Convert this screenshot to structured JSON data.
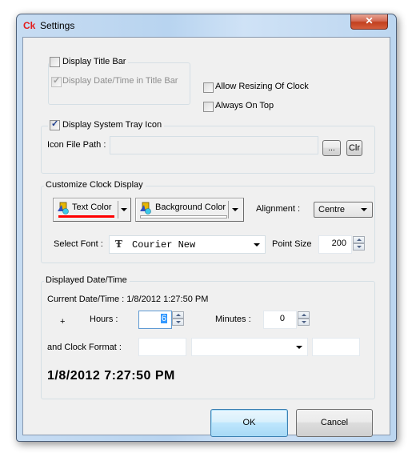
{
  "window": {
    "app_icon": "Ck",
    "title": "Settings",
    "close_label": "✕"
  },
  "title_bar_group": {
    "display_title_bar": {
      "label": "Display Title Bar",
      "checked": false
    },
    "display_datetime_in_title_bar": {
      "label": "Display Date/Time in Title Bar",
      "checked": true,
      "disabled": true
    }
  },
  "options": {
    "allow_resizing": {
      "label": "Allow Resizing Of Clock",
      "checked": false
    },
    "always_on_top": {
      "label": "Always On Top",
      "checked": false
    }
  },
  "tray_group": {
    "display_tray_icon": {
      "label": "Display System Tray Icon",
      "checked": true
    },
    "icon_path_label": "Icon File Path :",
    "icon_path_value": "",
    "browse_label": "...",
    "clear_label": "Clr"
  },
  "customize_group": {
    "legend": "Customize Clock Display",
    "text_color_label": "Text Color",
    "text_color_value": "#ff0000",
    "background_color_label": "Background Color",
    "background_color_value": "#ffffff",
    "alignment_label": "Alignment :",
    "alignment_value": "Centre",
    "font_label": "Select Font :",
    "font_value": "Courier New",
    "font_icon": "truetype-font-icon",
    "point_size_label": "Point Size",
    "point_size_value": "200"
  },
  "datetime_group": {
    "legend": "Displayed Date/Time",
    "current_label": "Current Date/Time : 1/8/2012 1:27:50 PM",
    "sign": "+",
    "hours_label": "Hours :",
    "hours_value": "6",
    "minutes_label": "Minutes :",
    "minutes_value": "0",
    "format_label": "and Clock Format :",
    "format_prefix": "",
    "format_select": "",
    "format_suffix": "",
    "preview": "1/8/2012 7:27:50 PM"
  },
  "footer": {
    "ok_label": "OK",
    "cancel_label": "Cancel"
  }
}
